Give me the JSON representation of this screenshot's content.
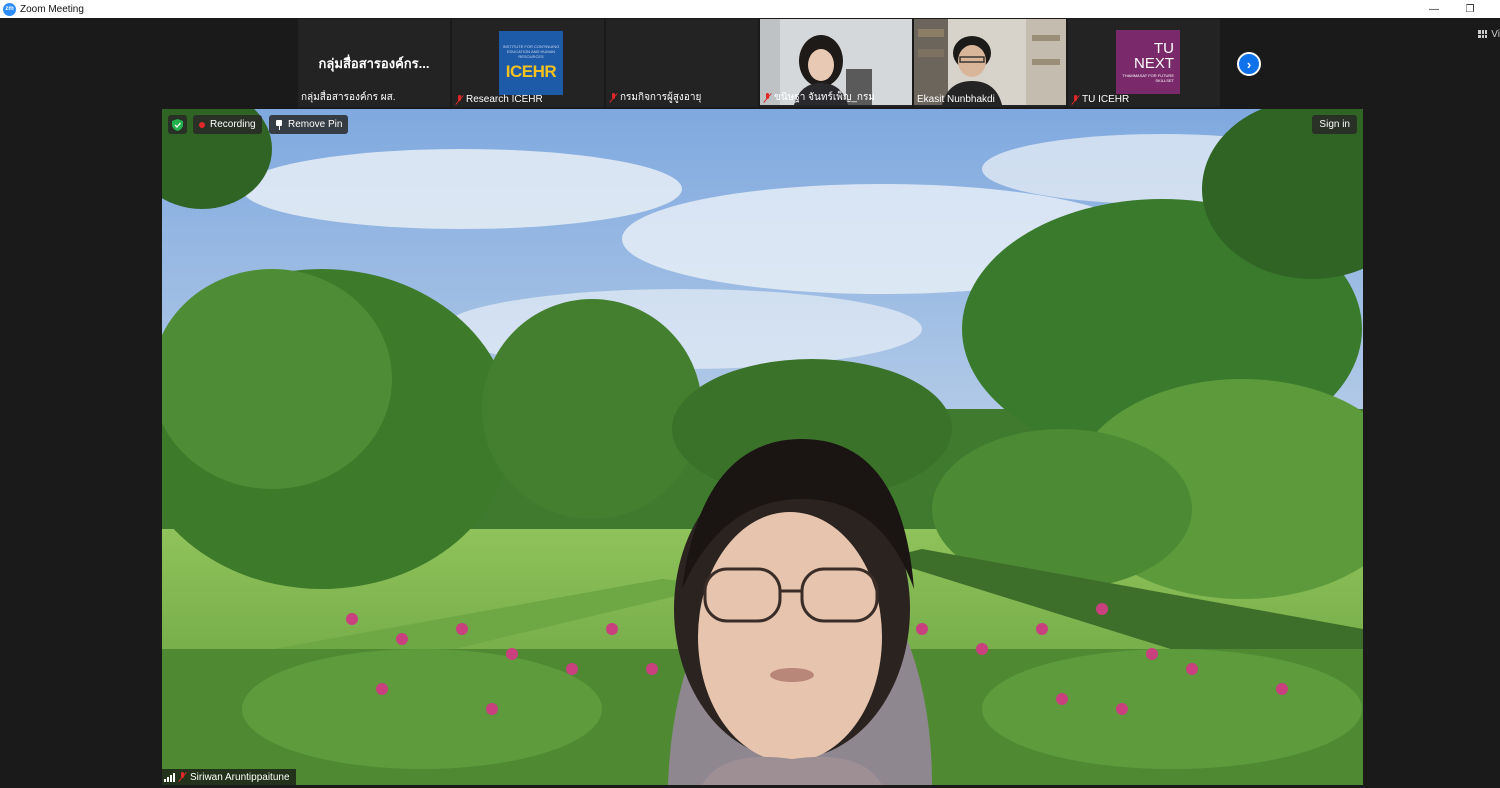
{
  "window": {
    "app_icon_text": "zm",
    "title": "Zoom Meeting",
    "minimize_glyph": "—",
    "restore_glyph": "❐"
  },
  "toolbar": {
    "view_label": "Vi"
  },
  "participants_strip": [
    {
      "tile_text": "กลุ่มสื่อสารองค์กร...",
      "name": "กลุ่มสื่อสารองค์กร ผส.",
      "muted": false
    },
    {
      "name": "Research ICEHR",
      "muted": true,
      "logo": {
        "small_text": "INSTITUTE FOR CONTINUING EDUCATION AND HUMAN RESOURCES",
        "main_text": "ICEHR"
      }
    },
    {
      "name": "กรมกิจการผู้สูงอายุ",
      "muted": true
    },
    {
      "name": "ขนิษฐา จันทร์เพ็ญ_กรม",
      "muted": true
    },
    {
      "name": "Ekasit Nunbhakdi",
      "muted": false
    },
    {
      "name": "TU ICEHR",
      "muted": true,
      "logo": {
        "line1": "TU",
        "line2": "NEXT",
        "line3": "THAMMASAT FOR FUTURE SKILLSET"
      }
    }
  ],
  "strip_next_glyph": "›",
  "main": {
    "recording_label": "Recording",
    "remove_pin_label": "Remove Pin",
    "sign_in_label": "Sign in",
    "speaker_name": "Siriwan Aruntippaitune"
  },
  "colors": {
    "accent": "#0e72ed",
    "recording": "#e02828",
    "encryption": "#22b14c"
  }
}
